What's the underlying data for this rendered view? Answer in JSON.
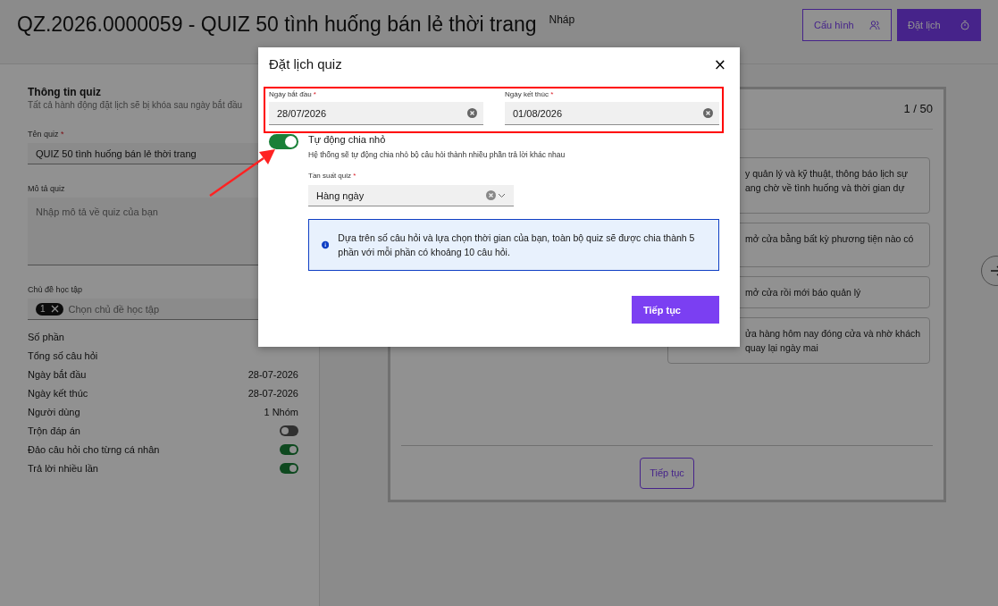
{
  "header": {
    "title": "QZ.2026.0000059 - QUIZ 50 tình huống bán lẻ thời trang",
    "status": "Nháp",
    "buttons": [
      {
        "label": "Cấu hình",
        "kind": "outline"
      },
      {
        "label": "Đặt lịch",
        "kind": "primary"
      }
    ]
  },
  "left_panel": {
    "title": "Thông tin quiz",
    "subtitle": "Tất cả hành động đặt lịch sẽ bị khóa sau ngày bắt đầu",
    "quiz_name": {
      "label": "Tên quiz",
      "required_mark": "*",
      "value": "QUIZ 50 tình huống bán lẻ thời trang"
    },
    "description": {
      "label": "Mô tả quiz",
      "placeholder": "Nhập mô tả về quiz của bạn"
    },
    "topics": {
      "label": "Chủ đề học tập",
      "chip": "1",
      "placeholder": "Chọn chủ đề học tập"
    },
    "summary": [
      {
        "kind": "text",
        "label": "Số phần"
      },
      {
        "kind": "text",
        "label": "Tổng số câu hỏi"
      },
      {
        "kind": "text",
        "label": "Ngày bắt đầu",
        "value": "28-07-2026"
      },
      {
        "kind": "text",
        "label": "Ngày kết thúc",
        "value": "28-07-2026"
      },
      {
        "kind": "text",
        "label": "Người dùng",
        "value": "1 Nhóm"
      },
      {
        "kind": "toggle",
        "label": "Trộn đáp án",
        "on": false
      },
      {
        "kind": "toggle",
        "label": "Đảo câu hỏi cho từng cá nhân",
        "on": true
      },
      {
        "kind": "toggle",
        "label": "Trả lời nhiều lần",
        "on": true
      }
    ]
  },
  "question_card": {
    "counter": "1 / 50",
    "options": [
      {
        "lines": [
          "y quản lý và kỹ thuật, thông báo lịch sự",
          "ang chờ về tình huống và thời gian dự"
        ]
      },
      {
        "lines": [
          "mở cửa bằng bất kỳ phương tiện nào có"
        ]
      },
      {
        "lines": [
          "mở cửa rồi mới báo quản lý"
        ]
      },
      {
        "lines": [
          "ửa hàng hôm nay đóng cửa và nhờ khách",
          "quay lại ngày mai"
        ]
      }
    ],
    "continue_button": "Tiếp tục"
  },
  "modal": {
    "title": "Đặt lịch quiz",
    "close": "×",
    "start_date": {
      "label": "Ngày bắt đầu",
      "required_mark": "*",
      "value": "28/07/2026"
    },
    "end_date": {
      "label": "Ngày kết thúc",
      "required_mark": "*",
      "value": "01/08/2026"
    },
    "auto_split": {
      "on": true,
      "label": "Tự động chia nhỏ",
      "description": "Hệ thống sẽ tự động chia nhỏ bộ câu hỏi thành nhiều phần trả lời khác nhau"
    },
    "frequency": {
      "label": "Tần suất quiz",
      "required_mark": "*",
      "value": "Hàng ngày"
    },
    "info": "Dựa trên số câu hỏi và lựa chọn thời gian của bạn, toàn bộ quiz sẽ được chia thành 5 phần với mỗi phần có khoảng 10 câu hỏi.",
    "submit": "Tiếp tục"
  }
}
